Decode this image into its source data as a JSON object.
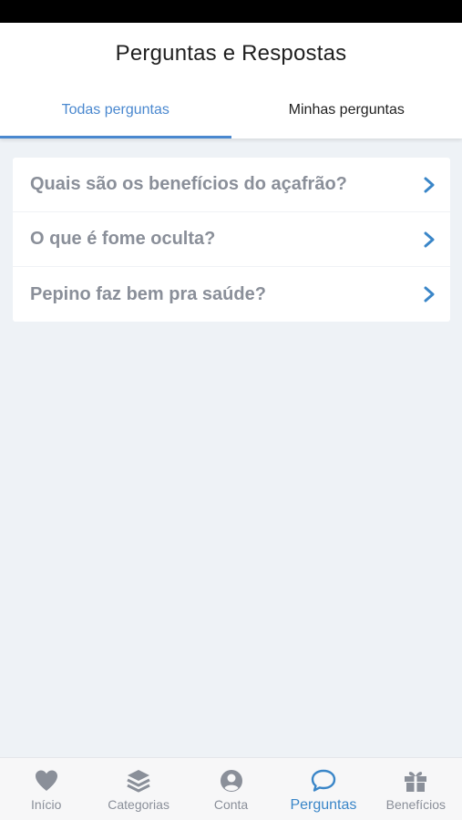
{
  "header": {
    "title": "Perguntas e Respostas",
    "tabs": [
      {
        "label": "Todas perguntas",
        "active": true
      },
      {
        "label": "Minhas perguntas",
        "active": false
      }
    ]
  },
  "questions": [
    {
      "text": "Quais são os benefícios do açafrão?"
    },
    {
      "text": "O que é fome oculta?"
    },
    {
      "text": "Pepino faz bem pra saúde?"
    }
  ],
  "bottom_nav": {
    "items": [
      {
        "label": "Início",
        "icon": "heart-icon",
        "active": false
      },
      {
        "label": "Categorias",
        "icon": "layers-icon",
        "active": false
      },
      {
        "label": "Conta",
        "icon": "user-circle-icon",
        "active": false
      },
      {
        "label": "Perguntas",
        "icon": "chat-bubble-icon",
        "active": true
      },
      {
        "label": "Benefícios",
        "icon": "gift-icon",
        "active": false
      }
    ]
  },
  "colors": {
    "accent": "#4a88cf",
    "nav_active": "#3a86c8",
    "muted_text": "#8a8f99",
    "background": "#eef2f6"
  }
}
